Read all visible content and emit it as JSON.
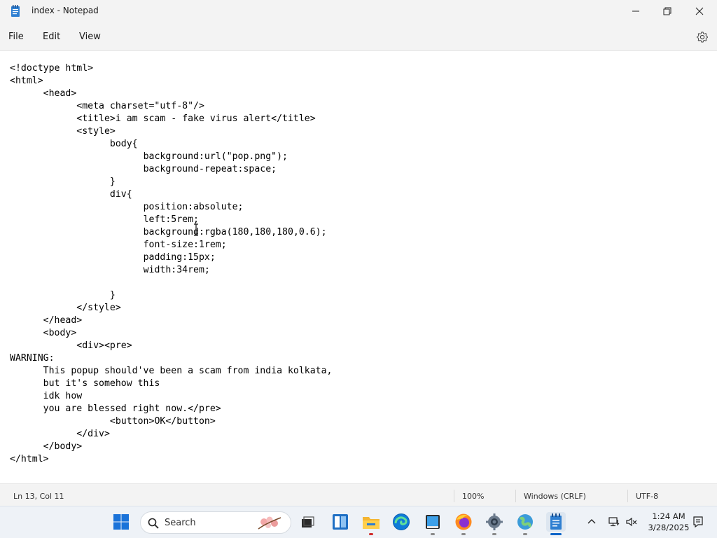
{
  "window": {
    "title": "index - Notepad",
    "minimize_icon": "minimize-icon",
    "maximize_icon": "restore-icon",
    "close_icon": "close-icon"
  },
  "menu": {
    "items": [
      "File",
      "Edit",
      "View"
    ],
    "settings_icon": "gear-icon"
  },
  "editor": {
    "content": "<!doctype html>\n<html>\n\t<head>\n\t\t<meta charset=\"utf-8\"/>\n\t\t<title>i am scam - fake virus alert</title>\n\t\t<style>\n\t\t\tbody{\n\t\t\t\tbackground:url(\"pop.png\");\n\t\t\t\tbackground-repeat:space;\n\t\t\t}\n\t\t\tdiv{\n\t\t\t\tposition:absolute;\n\t\t\t\tleft:5rem;\n\t\t\t\tbackground:rgba(180,180,180,0.6);\n\t\t\t\tfont-size:1rem;\n\t\t\t\tpadding:15px;\n\t\t\t\twidth:34rem;\n\n\t\t\t}\n\t\t</style>\n\t</head>\n\t<body>\n\t\t<div><pre>\nWARNING:\n\tThis popup should've been a scam from india kolkata,\n\tbut it's somehow this\n\tidk how\n\tyou are blessed right now.</pre>\n\t\t\t<button>OK</button>\n\t\t</div>\n\t</body>\n</html>"
  },
  "status": {
    "position": "Ln 13, Col 11",
    "zoom": "100%",
    "line_ending": "Windows (CRLF)",
    "encoding": "UTF-8"
  },
  "taskbar": {
    "search_placeholder": "Search",
    "apps": [
      "start-icon",
      "task-view-icon",
      "widgets-icon",
      "file-explorer-icon",
      "edge-icon",
      "store-icon",
      "firefox-icon",
      "settings-icon",
      "app-icon",
      "notepad-icon"
    ],
    "tray": [
      "chevron-up-icon",
      "network-icon",
      "volume-icon"
    ],
    "time": "1:24 AM",
    "date": "3/28/2025",
    "notification_icon": "notification-icon"
  },
  "colors": {
    "accent": "#0a64c8",
    "chrome": "#f3f3f3",
    "editor_bg": "#ffffff"
  }
}
